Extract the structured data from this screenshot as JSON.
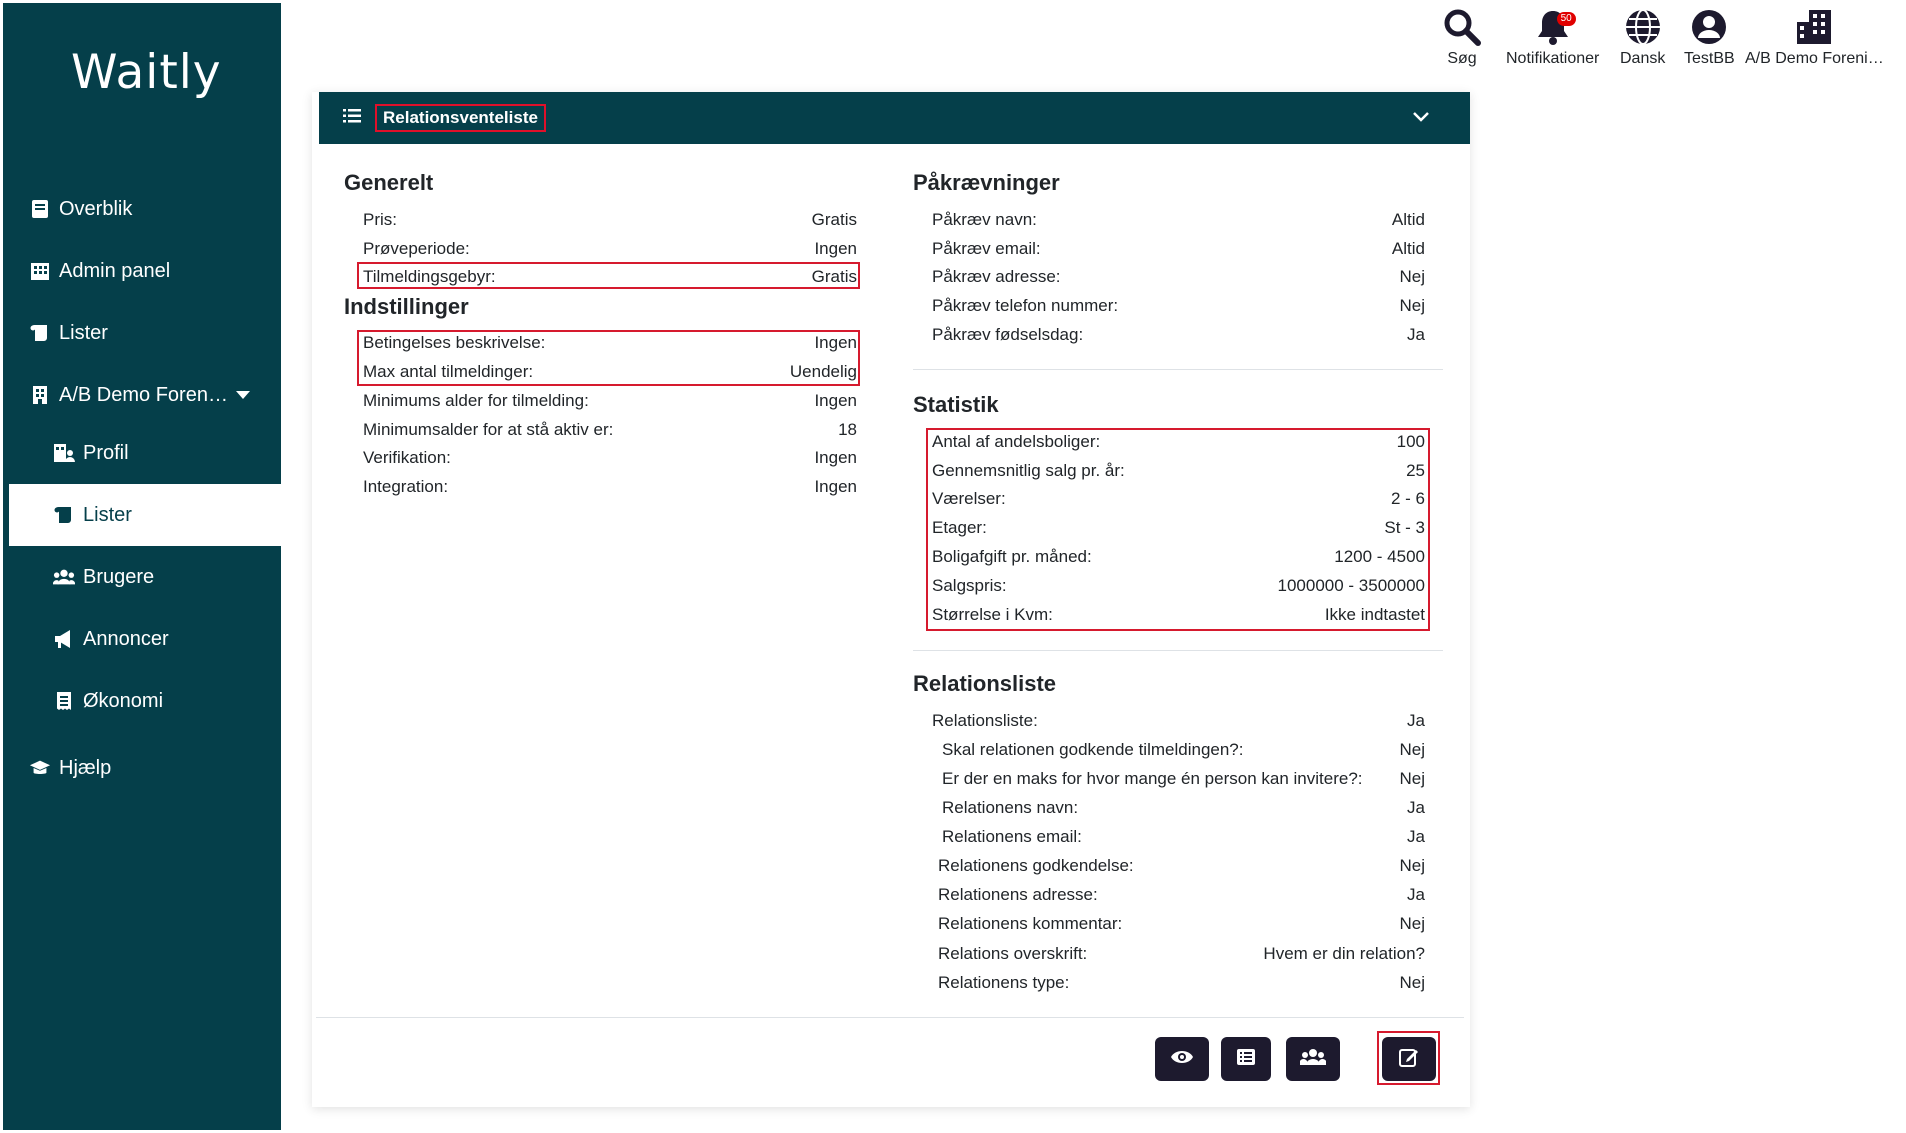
{
  "app": {
    "logo": "Waitly"
  },
  "sidebar": {
    "items": [
      {
        "label": "Overblik",
        "icon": "book-icon"
      },
      {
        "label": "Admin panel",
        "icon": "building-icon"
      },
      {
        "label": "Lister",
        "icon": "scroll-icon"
      },
      {
        "label": "A/B Demo Foren…",
        "icon": "building-icon"
      },
      {
        "label": "Profil",
        "icon": "building-user-icon"
      },
      {
        "label": "Lister",
        "icon": "scroll-icon"
      },
      {
        "label": "Brugere",
        "icon": "users-icon"
      },
      {
        "label": "Annoncer",
        "icon": "bullhorn-icon"
      },
      {
        "label": "Økonomi",
        "icon": "receipt-icon"
      },
      {
        "label": "Hjælp",
        "icon": "graduation-cap-icon"
      }
    ]
  },
  "topbar": {
    "search": "Søg",
    "notifications": "Notifikationer",
    "notifications_count": "50",
    "language": "Dansk",
    "user": "TestBB",
    "org": "A/B Demo Foreni…"
  },
  "card": {
    "title": "Relationsventeliste"
  },
  "generelt": {
    "title": "Generelt",
    "rows": [
      {
        "label": "Pris:",
        "value": "Gratis"
      },
      {
        "label": "Prøveperiode:",
        "value": "Ingen"
      },
      {
        "label": "Tilmeldingsgebyr:",
        "value": "Gratis"
      }
    ]
  },
  "indstillinger": {
    "title": "Indstillinger",
    "rows": [
      {
        "label": "Betingelses beskrivelse:",
        "value": "Ingen"
      },
      {
        "label": "Max antal tilmeldinger:",
        "value": "Uendelig"
      },
      {
        "label": "Minimums alder for tilmelding:",
        "value": "Ingen"
      },
      {
        "label": "Minimumsalder for at stå aktiv er:",
        "value": "18"
      },
      {
        "label": "Verifikation:",
        "value": "Ingen"
      },
      {
        "label": "Integration:",
        "value": "Ingen"
      }
    ]
  },
  "paakraevninger": {
    "title": "Påkrævninger",
    "rows": [
      {
        "label": "Påkræv navn:",
        "value": "Altid"
      },
      {
        "label": "Påkræv email:",
        "value": "Altid"
      },
      {
        "label": "Påkræv adresse:",
        "value": "Nej"
      },
      {
        "label": "Påkræv telefon nummer:",
        "value": "Nej"
      },
      {
        "label": "Påkræv fødselsdag:",
        "value": "Ja"
      }
    ]
  },
  "statistik": {
    "title": "Statistik",
    "rows": [
      {
        "label": "Antal af andelsboliger:",
        "value": "100"
      },
      {
        "label": "Gennemsnitlig salg pr. år:",
        "value": "25"
      },
      {
        "label": "Værelser:",
        "value": "2 - 6"
      },
      {
        "label": "Etager:",
        "value": "St - 3"
      },
      {
        "label": "Boligafgift pr. måned:",
        "value": "1200 - 4500"
      },
      {
        "label": "Salgspris:",
        "value": "1000000 - 3500000"
      },
      {
        "label": "Størrelse i Kvm:",
        "value": "Ikke indtastet"
      }
    ]
  },
  "relationsliste": {
    "title": "Relationsliste",
    "rows": [
      {
        "label": "Relationsliste:",
        "value": "Ja"
      },
      {
        "label": "Skal relationen godkende tilmeldingen?:",
        "value": "Nej"
      },
      {
        "label": "Er der en maks for hvor mange én person kan invitere?:",
        "value": "Nej"
      },
      {
        "label": "Relationens navn:",
        "value": "Ja"
      },
      {
        "label": "Relationens email:",
        "value": "Ja"
      },
      {
        "label": "Relationens godkendelse:",
        "value": "Nej"
      },
      {
        "label": "Relationens adresse:",
        "value": "Ja"
      },
      {
        "label": "Relationens kommentar:",
        "value": "Nej"
      },
      {
        "label": "Relations overskrift:",
        "value": "Hvem er din relation?"
      },
      {
        "label": "Relationens type:",
        "value": "Nej"
      }
    ]
  },
  "actions": [
    "eye-icon",
    "list-icon",
    "users-icon",
    "edit-icon"
  ]
}
